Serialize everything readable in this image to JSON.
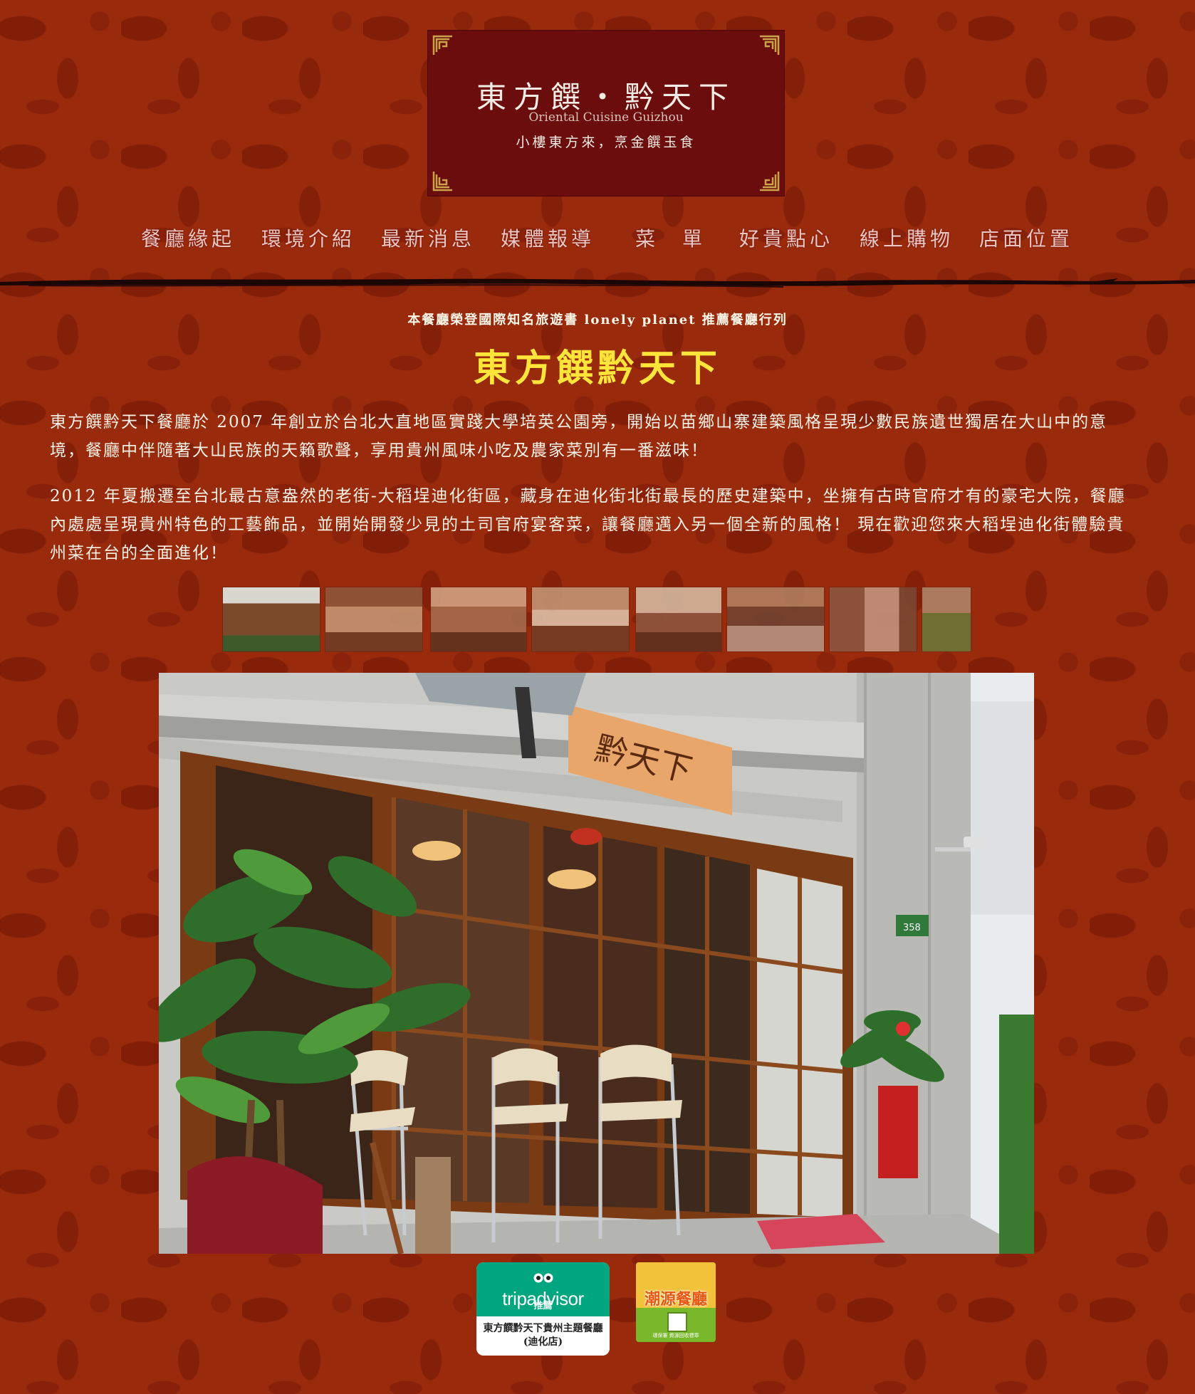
{
  "logo": {
    "title": "東方饌・黔天下",
    "subtitle": "Oriental Cuisine Guizhou",
    "slogan": "小樓東方來，烹金饌玉食"
  },
  "nav": {
    "items": [
      {
        "label": "餐廳緣起"
      },
      {
        "label": "環境介紹"
      },
      {
        "label": "最新消息"
      },
      {
        "label": "媒體報導"
      },
      {
        "label": "菜　單"
      },
      {
        "label": "好貴點心"
      },
      {
        "label": "線上購物"
      },
      {
        "label": "店面位置"
      }
    ]
  },
  "content": {
    "tagline": "本餐廳榮登國際知名旅遊書 lonely planet 推薦餐廳行列",
    "title": "東方饌黔天下",
    "paragraph1": "東方饌黔天下餐廳於 2007 年創立於台北大直地區實踐大學培英公園旁，開始以苗鄉山寨建築風格呈現少數民族遺世獨居在大山中的意境，餐廳中伴隨著大山民族的天籟歌聲，享用貴州風味小吃及農家菜別有一番滋味！",
    "paragraph2": "2012 年夏搬遷至台北最古意盎然的老街-大稻埕迪化街區，藏身在迪化街北街最長的歷史建築中，坐擁有古時官府才有的豪宅大院，餐廳內處處呈現貴州特色的工藝飾品，並開始開發少見的土司官府宴客菜，讓餐廳邁入另一個全新的風格！ 現在歡迎您來大稻埕迪化街體驗貴州菜在台的全面進化！"
  },
  "gallery": {
    "thumbnails": [
      "storefront",
      "dining-hall",
      "dining-room",
      "banquet-room",
      "lounge",
      "street-view",
      "alley-view",
      "garden"
    ]
  },
  "hero": {
    "sign_text": "黔天下",
    "address_plate": "358"
  },
  "badges": {
    "tripadvisor": {
      "logo": "tripadvisor",
      "recommend": "推薦",
      "name": "東方饌黔天下貴州主題餐廳(迪化店)"
    },
    "eco": {
      "label": "潮源餐廳",
      "footer": "環保署 資源回收標章"
    }
  },
  "colors": {
    "background": "#9a2a0c",
    "logo_box": "#6b0d0c",
    "title_yellow": "#ffe53a",
    "nav_text": "#ecc6c0",
    "tripadvisor_green": "#00a680"
  }
}
